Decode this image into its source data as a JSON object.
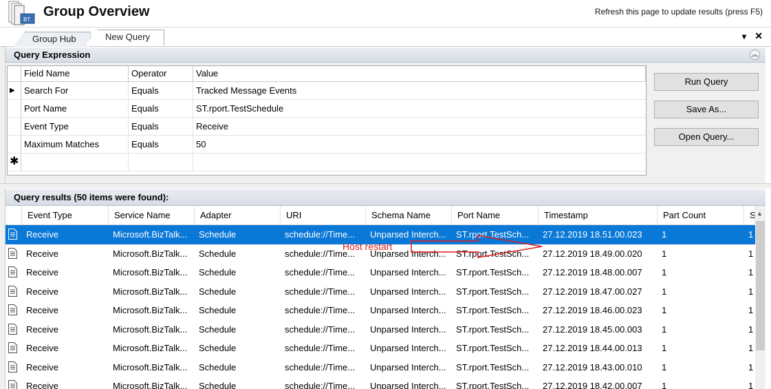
{
  "window": {
    "title": "Group Overview",
    "refresh_hint": "Refresh this page to update results (press F5)",
    "icon": "biztalk-group-icon"
  },
  "tabs": [
    {
      "label": "Group Hub",
      "active": false
    },
    {
      "label": "New Query",
      "active": true
    }
  ],
  "tab_controls": {
    "pin": "▾",
    "close": "✕"
  },
  "query_expression": {
    "title": "Query Expression",
    "columns": [
      "Field Name",
      "Operator",
      "Value"
    ],
    "rows": [
      {
        "field": "Search For",
        "operator": "Equals",
        "value": "Tracked Message Events"
      },
      {
        "field": "Port Name",
        "operator": "Equals",
        "value": "ST.rport.TestSchedule"
      },
      {
        "field": "Event Type",
        "operator": "Equals",
        "value": "Receive"
      },
      {
        "field": "Maximum Matches",
        "operator": "Equals",
        "value": "50"
      }
    ],
    "current_row_marker": "▶",
    "new_row_marker": "✱",
    "buttons": {
      "run": "Run Query",
      "save": "Save As...",
      "open": "Open Query..."
    }
  },
  "results": {
    "title": "Query results (50 items were found):",
    "columns": [
      "Event Type",
      "Service Name",
      "Adapter",
      "URI",
      "Schema Name",
      "Port Name",
      "Timestamp",
      "Part Count",
      "S"
    ],
    "rows": [
      {
        "event_type": "Receive",
        "service": "Microsoft.BizTalk...",
        "adapter": "Schedule",
        "uri": "schedule://Time...",
        "schema": "Unparsed Interch...",
        "port": "ST.rport.TestSch...",
        "timestamp": "27.12.2019 18.51.00.023",
        "part_count": "1",
        "s": "1"
      },
      {
        "event_type": "Receive",
        "service": "Microsoft.BizTalk...",
        "adapter": "Schedule",
        "uri": "schedule://Time...",
        "schema": "Unparsed Interch...",
        "port": "ST.rport.TestSch...",
        "timestamp": "27.12.2019 18.49.00.020",
        "part_count": "1",
        "s": "1"
      },
      {
        "event_type": "Receive",
        "service": "Microsoft.BizTalk...",
        "adapter": "Schedule",
        "uri": "schedule://Time...",
        "schema": "Unparsed Interch...",
        "port": "ST.rport.TestSch...",
        "timestamp": "27.12.2019 18.48.00.007",
        "part_count": "1",
        "s": "1"
      },
      {
        "event_type": "Receive",
        "service": "Microsoft.BizTalk...",
        "adapter": "Schedule",
        "uri": "schedule://Time...",
        "schema": "Unparsed Interch...",
        "port": "ST.rport.TestSch...",
        "timestamp": "27.12.2019 18.47.00.027",
        "part_count": "1",
        "s": "1"
      },
      {
        "event_type": "Receive",
        "service": "Microsoft.BizTalk...",
        "adapter": "Schedule",
        "uri": "schedule://Time...",
        "schema": "Unparsed Interch...",
        "port": "ST.rport.TestSch...",
        "timestamp": "27.12.2019 18.46.00.023",
        "part_count": "1",
        "s": "1"
      },
      {
        "event_type": "Receive",
        "service": "Microsoft.BizTalk...",
        "adapter": "Schedule",
        "uri": "schedule://Time...",
        "schema": "Unparsed Interch...",
        "port": "ST.rport.TestSch...",
        "timestamp": "27.12.2019 18.45.00.003",
        "part_count": "1",
        "s": "1"
      },
      {
        "event_type": "Receive",
        "service": "Microsoft.BizTalk...",
        "adapter": "Schedule",
        "uri": "schedule://Time...",
        "schema": "Unparsed Interch...",
        "port": "ST.rport.TestSch...",
        "timestamp": "27.12.2019 18.44.00.013",
        "part_count": "1",
        "s": "1"
      },
      {
        "event_type": "Receive",
        "service": "Microsoft.BizTalk...",
        "adapter": "Schedule",
        "uri": "schedule://Time...",
        "schema": "Unparsed Interch...",
        "port": "ST.rport.TestSch...",
        "timestamp": "27.12.2019 18.43.00.010",
        "part_count": "1",
        "s": "1"
      },
      {
        "event_type": "Receive",
        "service": "Microsoft.BizTalk...",
        "adapter": "Schedule",
        "uri": "schedule://Time...",
        "schema": "Unparsed Interch...",
        "port": "ST.rport.TestSch...",
        "timestamp": "27.12.2019 18.42.00.007",
        "part_count": "1",
        "s": "1"
      }
    ],
    "selected_row": 0
  },
  "annotation": {
    "text": "Host restart",
    "color": "#e21c1c"
  },
  "colors": {
    "selection": "#0a78d7",
    "panel": "#f0f0f0"
  }
}
